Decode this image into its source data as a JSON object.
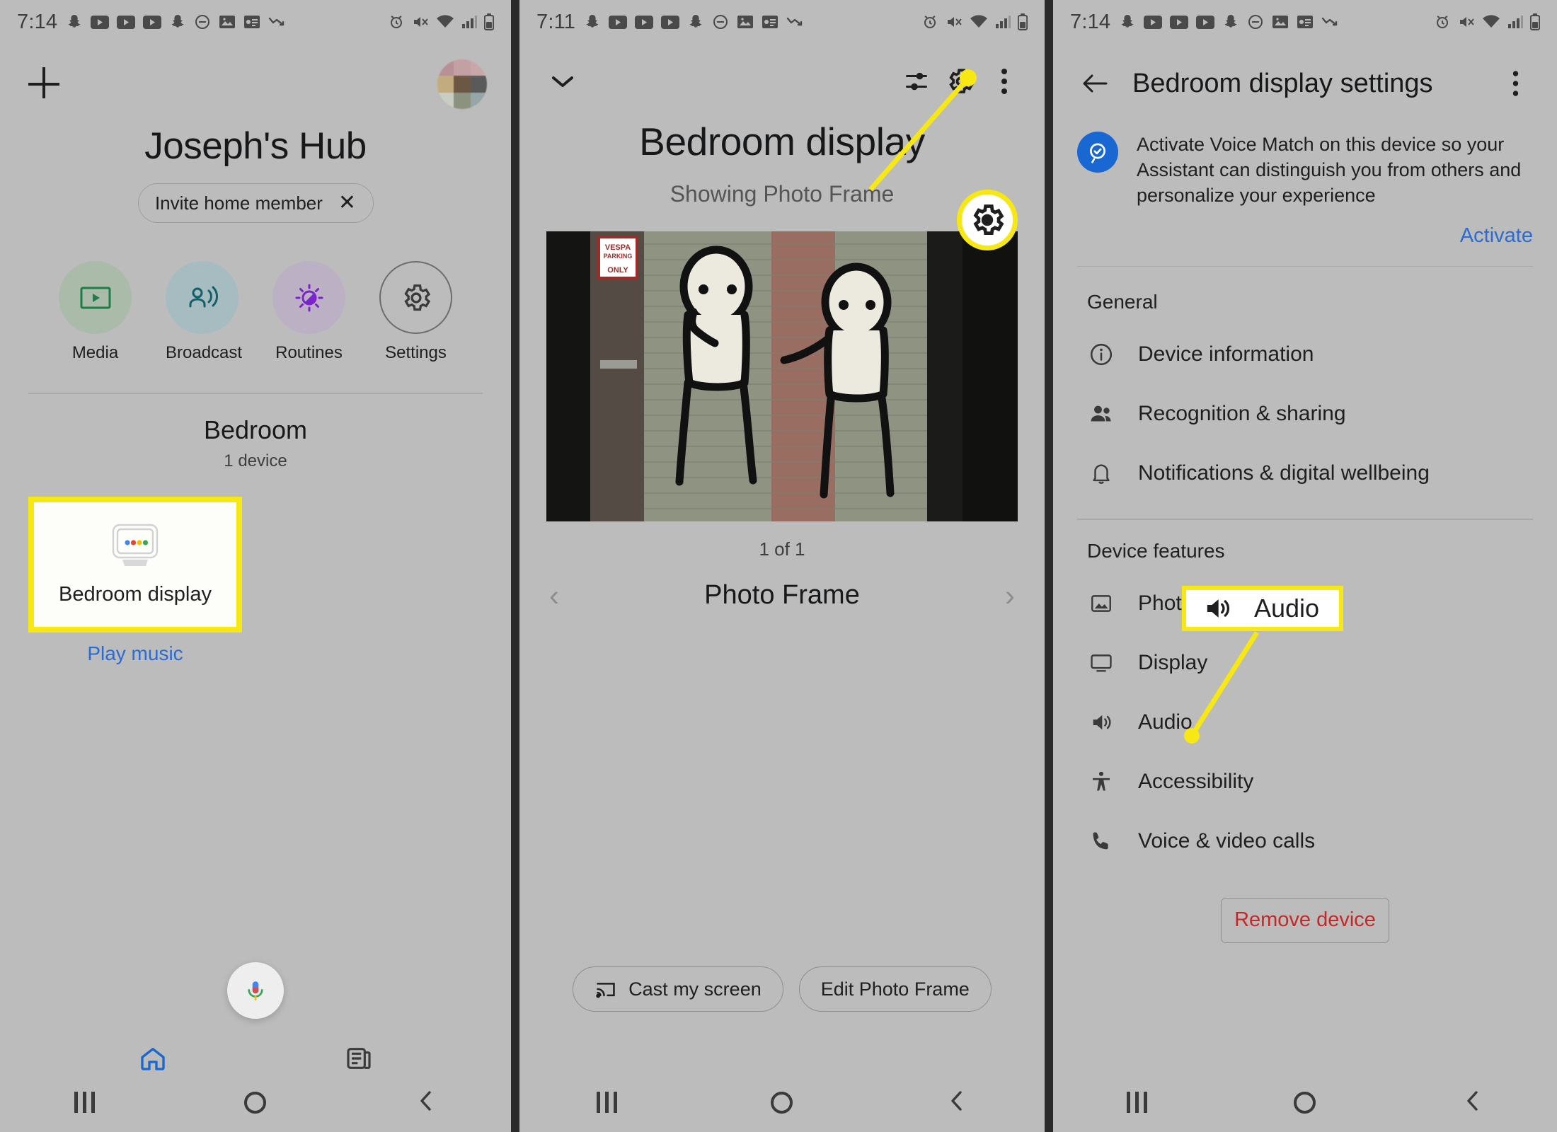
{
  "panel1": {
    "status": {
      "time": "7:14",
      "icons": [
        "snapchat-icon",
        "youtube-icon",
        "youtube-icon",
        "youtube-icon",
        "snapchat-icon",
        "do-not-disturb-icon",
        "image-icon",
        "news-icon",
        "data-saver-icon",
        "alarm-icon",
        "mute-icon",
        "wifi-icon",
        "signal-icon",
        "battery-icon"
      ]
    },
    "add_label": "+",
    "hub_title": "Joseph's Hub",
    "invite_chip": {
      "label": "Invite home member",
      "dismiss": "✕"
    },
    "quick_actions": [
      {
        "label": "Media",
        "icon": "media-icon",
        "bubble": "#aabba9",
        "stroke": "#1e7d46"
      },
      {
        "label": "Broadcast",
        "icon": "broadcast-icon",
        "bubble": "#a7bcc0",
        "stroke": "#11616b"
      },
      {
        "label": "Routines",
        "icon": "routines-icon",
        "bubble": "#bbb0c4",
        "stroke": "#7b23cc"
      },
      {
        "label": "Settings",
        "icon": "settings-icon",
        "bubble": "transparent",
        "stroke": "#3a3a3a"
      }
    ],
    "room": {
      "name": "Bedroom",
      "device_count": "1 device"
    },
    "device_card": {
      "name": "Bedroom display",
      "icon": "google-hub-display-icon"
    },
    "play_music": "Play music",
    "mic": "mic-icon",
    "nav_tabs": [
      "home-tab",
      "feed-tab"
    ]
  },
  "panel2": {
    "status": {
      "time": "7:11"
    },
    "collapse": "chevron-down-icon",
    "toolbar": [
      "tune-icon",
      "settings-gear-icon",
      "overflow-menu-icon"
    ],
    "title": "Bedroom display",
    "subtitle": "Showing Photo Frame",
    "photo_counter": "1 of 1",
    "frame_name": "Photo Frame",
    "prev": "‹",
    "next": "›",
    "actions": [
      {
        "label": "Cast my screen",
        "icon": "cast-icon"
      },
      {
        "label": "Edit Photo Frame",
        "icon": null
      }
    ],
    "callout_gear": "settings-gear-icon"
  },
  "panel3": {
    "status": {
      "time": "7:14"
    },
    "back": "back-arrow-icon",
    "title": "Bedroom display settings",
    "overflow": "overflow-menu-icon",
    "voice_match": {
      "icon": "voice-match-icon",
      "text": "Activate Voice Match on this device so your Assistant can distinguish you from others and personalize your experience",
      "action": "Activate"
    },
    "sections": [
      {
        "heading": "General",
        "items": [
          {
            "label": "Device information",
            "icon": "info-icon"
          },
          {
            "label": "Recognition & sharing",
            "icon": "people-icon"
          },
          {
            "label": "Notifications & digital wellbeing",
            "icon": "bell-icon"
          }
        ]
      },
      {
        "heading": "Device features",
        "items": [
          {
            "label": "Photo Frame",
            "icon": "photo-icon"
          },
          {
            "label": "Display",
            "icon": "display-icon"
          },
          {
            "label": "Audio",
            "icon": "audio-icon"
          },
          {
            "label": "Accessibility",
            "icon": "accessibility-icon"
          },
          {
            "label": "Voice & video calls",
            "icon": "phone-icon"
          }
        ]
      }
    ],
    "remove_device": "Remove device",
    "callout": {
      "label": "Audio",
      "icon": "audio-icon"
    }
  },
  "colors": {
    "highlight_yellow": "#f7e713",
    "link_blue": "#2a6cd4",
    "danger_red": "#c62828",
    "screen_bg": "#bcbcbc",
    "voice_match_blue": "#1967d2"
  }
}
